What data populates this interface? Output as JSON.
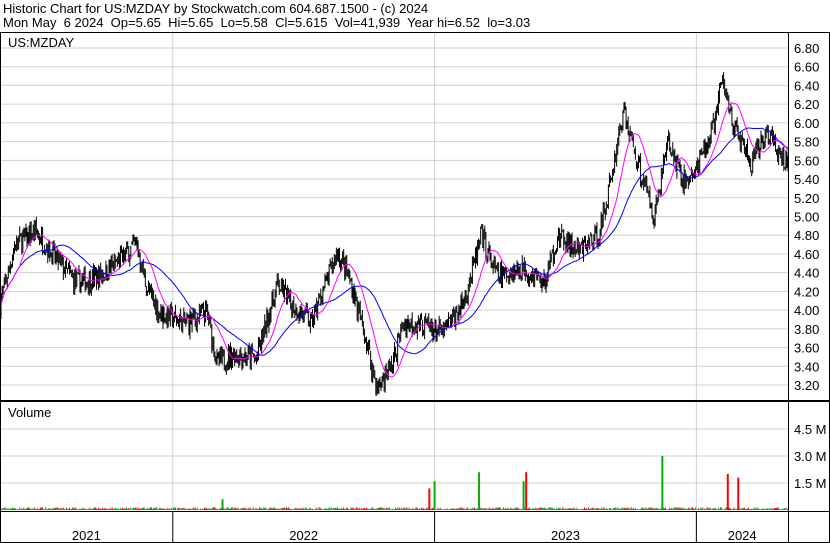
{
  "header": {
    "title": "Historic Chart for US:MZDAY by Stockwatch.com 604.687.1500 - (c) 2024",
    "quote": "Mon May  6 2024  Op=5.65  Hi=5.65  Lo=5.58  Cl=5.615  Vol=41,939  Year hi=6.52  lo=3.03"
  },
  "chart_data": {
    "type": "line",
    "subtype": "ohlc-bars-with-moving-averages-and-volume",
    "symbol_label": "US:MZDAY",
    "volume_label": "Volume",
    "price_ticks": [
      "6.80",
      "6.60",
      "6.40",
      "6.20",
      "6.00",
      "5.80",
      "5.60",
      "5.40",
      "5.20",
      "5.00",
      "4.80",
      "4.60",
      "4.40",
      "4.20",
      "4.00",
      "3.80",
      "3.60",
      "3.40",
      "3.20"
    ],
    "price_ylim": [
      3.04,
      6.96
    ],
    "volume_ticks": [
      "4.5 M",
      "3.0 M",
      "1.5 M"
    ],
    "volume_ylim_millions": [
      0,
      6.0
    ],
    "x_labels": [
      "2021",
      "2022",
      "2023",
      "2024"
    ],
    "x_range_years": [
      2021.34,
      2024.35
    ],
    "approx_close_anchors": [
      [
        2021.34,
        4.08
      ],
      [
        2021.4,
        4.72
      ],
      [
        2021.48,
        4.83
      ],
      [
        2021.55,
        4.56
      ],
      [
        2021.63,
        4.29
      ],
      [
        2021.71,
        4.35
      ],
      [
        2021.79,
        4.51
      ],
      [
        2021.86,
        4.72
      ],
      [
        2021.9,
        4.24
      ],
      [
        2021.95,
        3.97
      ],
      [
        2022.05,
        3.86
      ],
      [
        2022.13,
        3.97
      ],
      [
        2022.17,
        3.43
      ],
      [
        2022.24,
        3.54
      ],
      [
        2022.32,
        3.48
      ],
      [
        2022.4,
        4.29
      ],
      [
        2022.45,
        4.08
      ],
      [
        2022.53,
        3.86
      ],
      [
        2022.57,
        4.18
      ],
      [
        2022.63,
        4.62
      ],
      [
        2022.68,
        4.29
      ],
      [
        2022.74,
        3.65
      ],
      [
        2022.78,
        3.16
      ],
      [
        2022.84,
        3.43
      ],
      [
        2022.88,
        3.86
      ],
      [
        2022.95,
        3.86
      ],
      [
        2023.03,
        3.75
      ],
      [
        2023.11,
        4.08
      ],
      [
        2023.18,
        4.78
      ],
      [
        2023.24,
        4.35
      ],
      [
        2023.34,
        4.45
      ],
      [
        2023.42,
        4.29
      ],
      [
        2023.47,
        4.78
      ],
      [
        2023.55,
        4.62
      ],
      [
        2023.63,
        4.83
      ],
      [
        2023.68,
        5.48
      ],
      [
        2023.72,
        6.13
      ],
      [
        2023.78,
        5.54
      ],
      [
        2023.84,
        5.0
      ],
      [
        2023.89,
        5.81
      ],
      [
        2023.95,
        5.37
      ],
      [
        2024.0,
        5.48
      ],
      [
        2024.06,
        5.91
      ],
      [
        2024.1,
        6.45
      ],
      [
        2024.15,
        5.91
      ],
      [
        2024.21,
        5.54
      ],
      [
        2024.27,
        5.91
      ],
      [
        2024.33,
        5.59
      ],
      [
        2024.35,
        5.615
      ]
    ],
    "volume_spikes_millions": [
      {
        "t": 2022.19,
        "v": 0.6,
        "dir": "up"
      },
      {
        "t": 2022.98,
        "v": 1.2,
        "dir": "down"
      },
      {
        "t": 2023.0,
        "v": 1.6,
        "dir": "up"
      },
      {
        "t": 2023.17,
        "v": 2.1,
        "dir": "up"
      },
      {
        "t": 2023.34,
        "v": 1.6,
        "dir": "up"
      },
      {
        "t": 2023.35,
        "v": 2.1,
        "dir": "down"
      },
      {
        "t": 2023.87,
        "v": 3.0,
        "dir": "up"
      },
      {
        "t": 2024.12,
        "v": 2.0,
        "dir": "down"
      },
      {
        "t": 2024.16,
        "v": 1.8,
        "dir": "down"
      }
    ],
    "series": [
      {
        "name": "price bars",
        "color": "#000000"
      },
      {
        "name": "short moving average",
        "color": "#ff00ff"
      },
      {
        "name": "long moving average",
        "color": "#0000ff"
      }
    ],
    "colors": {
      "up_volume": "#00b000",
      "down_volume": "#ff0000",
      "grid": "#d0d0d0"
    },
    "grid": true
  }
}
